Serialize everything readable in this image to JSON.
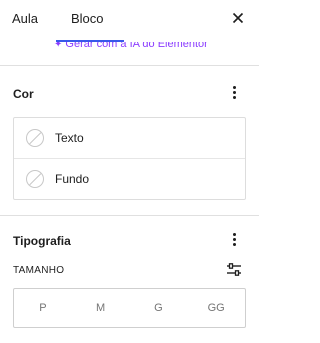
{
  "tabs": [
    {
      "label": "Aula"
    },
    {
      "label": "Bloco"
    }
  ],
  "ai_link": {
    "text": "Gerar com a IA do Elementor"
  },
  "color_section": {
    "title": "Cor",
    "items": [
      {
        "label": "Texto"
      },
      {
        "label": "Fundo"
      }
    ]
  },
  "typography_section": {
    "title": "Tipografia",
    "size_label": "TAMANHO",
    "sizes": [
      "P",
      "M",
      "G",
      "GG"
    ]
  },
  "colors": {
    "accent": "#3858e9",
    "ai_purple": "#8b3dff"
  }
}
